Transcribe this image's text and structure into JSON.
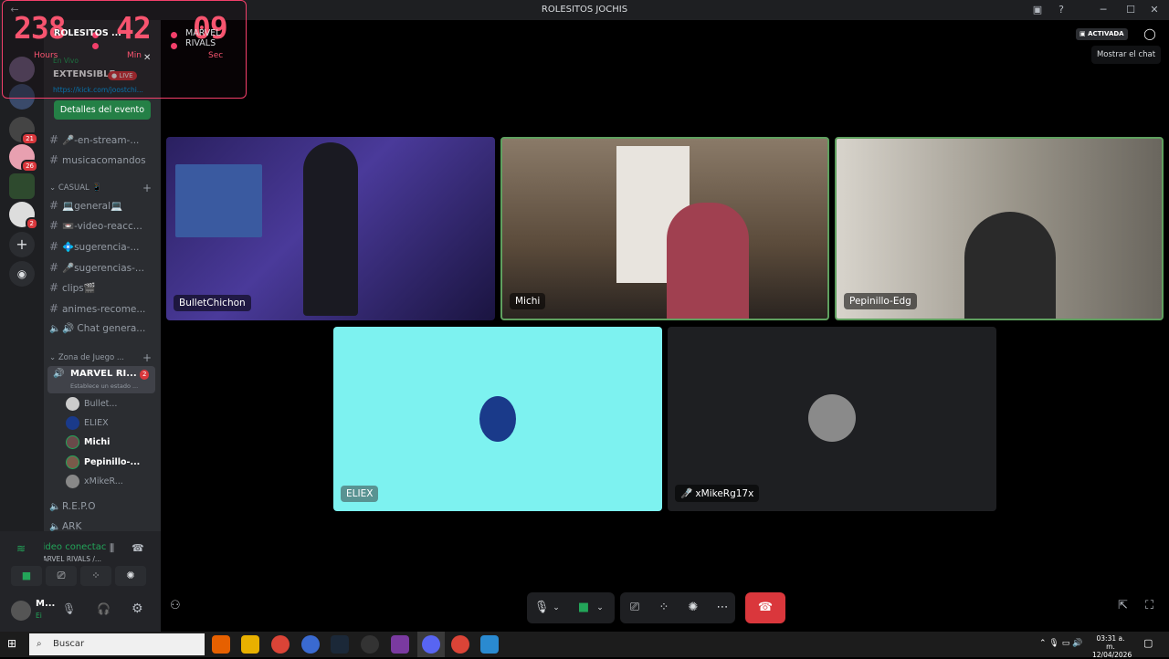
{
  "window": {
    "title": "ROLESITOS JOCHIS",
    "back_icon": "←",
    "forward_icon": "→"
  },
  "timer": {
    "hours": "238",
    "minutes": "42",
    "seconds": "09",
    "hours_label": "Hours",
    "minutes_label": "Min",
    "seconds_label": "Sec",
    "accent": "#f7546f"
  },
  "header": {
    "server_name": "ROLESITOS ...",
    "channel_name": "MARVEL RIVALS",
    "activated_label": "ACTIVADA",
    "tooltip": "Mostrar el chat"
  },
  "event": {
    "live_tag": "En Vivo",
    "live_badge": "● LIVE",
    "title": "EXTENSIBLE",
    "link": "https://kick.com/joostchi...",
    "details_button": "Detalles del evento"
  },
  "servers": [
    {
      "badge": ""
    },
    {
      "badge": ""
    },
    {
      "badge": "21"
    },
    {
      "badge": "26"
    },
    {
      "badge": ""
    },
    {
      "badge": "2"
    }
  ],
  "channels": {
    "top": [
      {
        "icon": "#",
        "label": "🎤-en-stream-..."
      },
      {
        "icon": "#",
        "label": "musicacomandos"
      }
    ],
    "casual_category": "CASUAL 📱",
    "casual": [
      {
        "icon": "#",
        "label": "💻general💻"
      },
      {
        "icon": "#",
        "label": "📼-video-reacc..."
      },
      {
        "icon": "#",
        "label": "💠sugerencia-..."
      },
      {
        "icon": "#",
        "label": "🎤sugerencias-..."
      },
      {
        "icon": "#",
        "label": "clips🎬"
      },
      {
        "icon": "#",
        "label": "animes-recome..."
      },
      {
        "icon": "🔊",
        "label": "🔊 Chat genera..."
      }
    ],
    "game_category": "Zona de Juego ...",
    "voice_channel": {
      "label": "MARVEL RI...",
      "badge": "2",
      "status": "Establece un estado ..."
    },
    "voice_users": [
      "Bullet...",
      "ELIEX",
      "Michi",
      "Pepinillo-...",
      "xMikeR..."
    ],
    "after": [
      {
        "icon": "🔊",
        "label": "R.E.P.O"
      },
      {
        "icon": "🔊",
        "label": "ARK"
      }
    ]
  },
  "voice_panel": {
    "status": "Video conectac",
    "channel": "MARVEL RIVALS /...",
    "user_name": "M...",
    "user_status": "Ei"
  },
  "participants": [
    {
      "name": "BulletChichon"
    },
    {
      "name": "Michi"
    },
    {
      "name": "Pepinillo-Edg"
    },
    {
      "name": "ELIEX"
    },
    {
      "name": "xMikeRg17x"
    }
  ],
  "colors": {
    "speaking_border": "#5fa05f",
    "eliex_bg": "#7df2f0",
    "hangup": "#da373c",
    "connected_green": "#23a559"
  },
  "taskbar": {
    "search_placeholder": "Buscar",
    "time": "03:31 a. m.",
    "date": "12/04/2026"
  }
}
